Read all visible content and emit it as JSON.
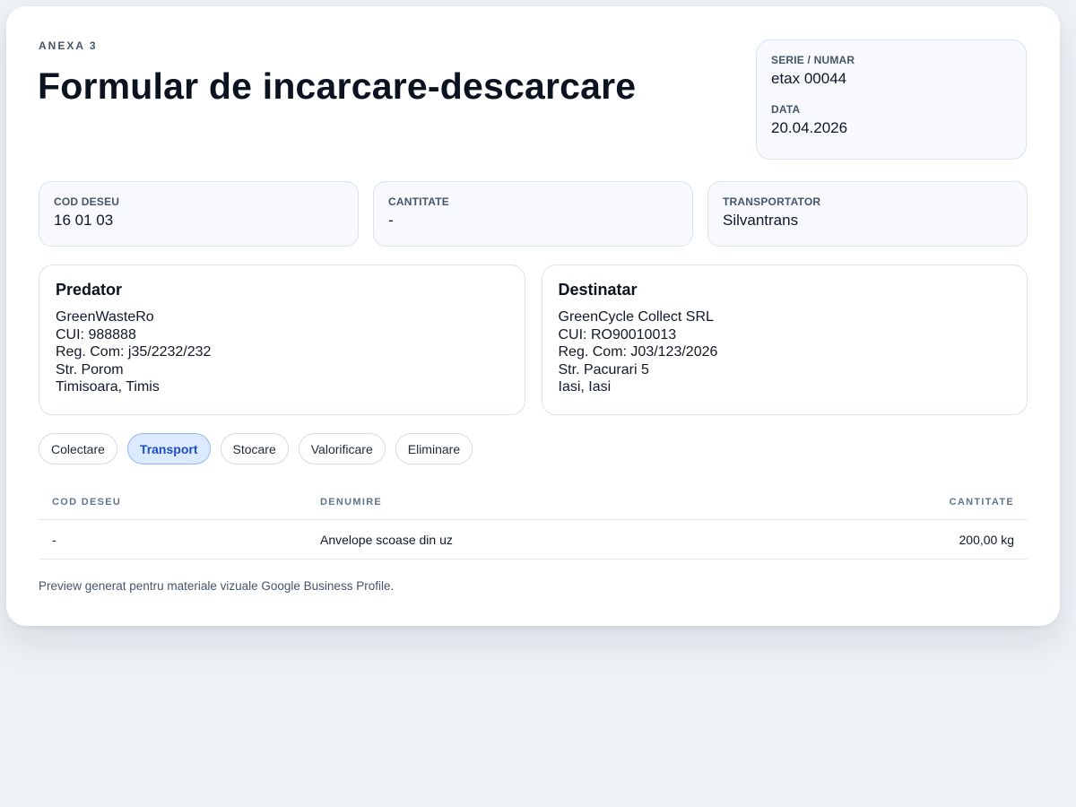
{
  "header": {
    "eyebrow": "ANEXA 3",
    "title": "Formular de incarcare-descarcare"
  },
  "meta": {
    "serie_label": "SERIE / NUMAR",
    "serie_value": "etax 00044",
    "data_label": "DATA",
    "data_value": "20.04.2026"
  },
  "info": {
    "cod_label": "COD DESEU",
    "cod_value": "16 01 03",
    "cantitate_label": "CANTITATE",
    "cantitate_value": "-",
    "transportator_label": "TRANSPORTATOR",
    "transportator_value": "Silvantrans"
  },
  "predator": {
    "title": "Predator",
    "lines": [
      "GreenWasteRo",
      "CUI: 988888",
      "Reg. Com: j35/2232/232",
      "Str. Porom",
      "Timisoara, Timis"
    ]
  },
  "destinatar": {
    "title": "Destinatar",
    "lines": [
      "GreenCycle Collect SRL",
      "CUI: RO90010013",
      "Reg. Com: J03/123/2026",
      "Str. Pacurari 5",
      "Iasi, Iasi"
    ]
  },
  "operations": {
    "items": [
      "Colectare",
      "Transport",
      "Stocare",
      "Valorificare",
      "Eliminare"
    ],
    "active": "Transport"
  },
  "table": {
    "headers": [
      "COD DESEU",
      "DENUMIRE",
      "CANTITATE"
    ],
    "rows": [
      [
        "-",
        "Anvelope scoase din uz",
        "200,00 kg"
      ]
    ]
  },
  "footer": {
    "note": "Preview generat pentru materiale vizuale Google Business Profile."
  },
  "colors": {
    "accent": "#1e4fc1",
    "accent_bg": "#dbeafe",
    "page_bg": "#eef2f6"
  }
}
